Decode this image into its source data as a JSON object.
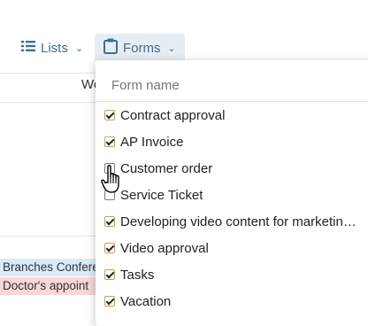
{
  "toolbar": {
    "lists_label": "Lists",
    "forms_label": "Forms"
  },
  "calendar": {
    "column_header": "We",
    "events": [
      "Branches Confere",
      "Doctor's appoint"
    ],
    "event_colors": [
      "#d9eaf7",
      "#f8d7d4"
    ]
  },
  "forms_dropdown": {
    "search_placeholder": "Form name",
    "items": [
      {
        "label": "Contract approval",
        "checked": true
      },
      {
        "label": "AP Invoice",
        "checked": true
      },
      {
        "label": "Customer order",
        "checked": false
      },
      {
        "label": "Service Ticket",
        "checked": false
      },
      {
        "label": "Developing video content for marketing e...",
        "checked": true
      },
      {
        "label": "Video approval",
        "checked": true
      },
      {
        "label": "Tasks",
        "checked": true
      },
      {
        "label": "Vacation",
        "checked": true
      }
    ]
  },
  "colors": {
    "accent": "#3d6f93",
    "forms_button_bg": "#e7eef3",
    "checkbox_border": "#caa24a"
  },
  "icons": [
    "list-icon",
    "clipboard-icon",
    "chevron-down-icon",
    "hand-cursor-icon"
  ]
}
